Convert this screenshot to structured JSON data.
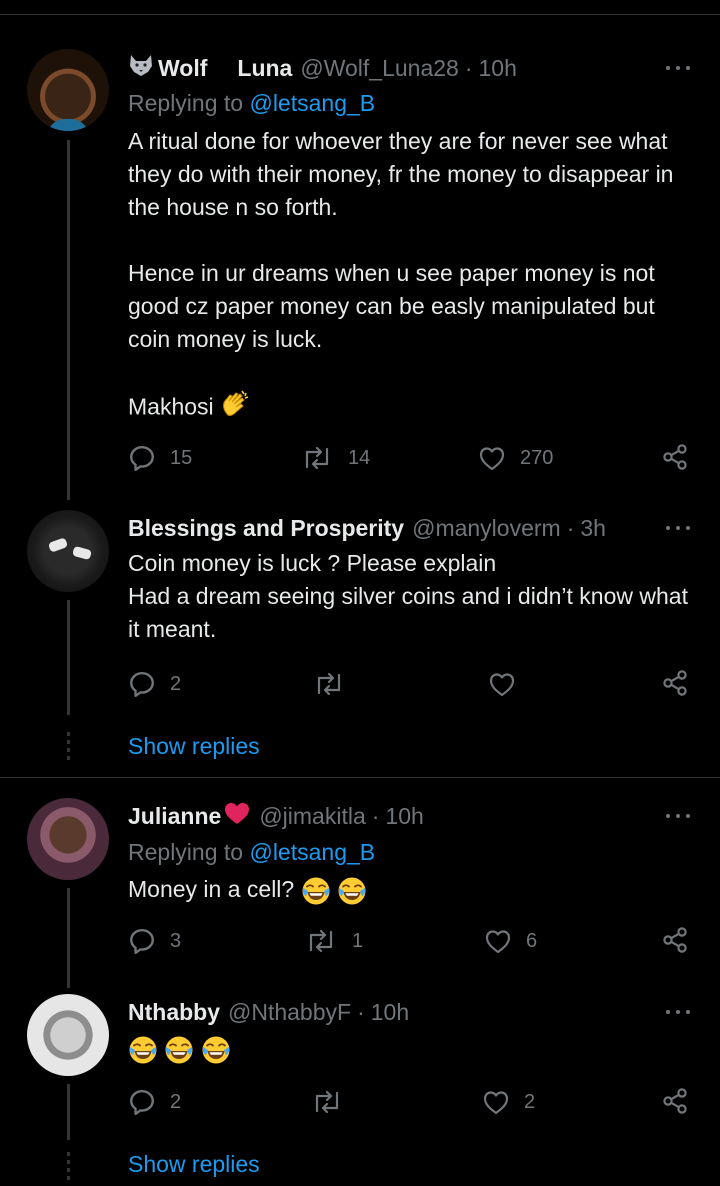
{
  "tweets": [
    {
      "name": "Wolf",
      "name2": "Luna",
      "handle": "@Wolf_Luna28",
      "time": "10h",
      "replying_label": "Replying to",
      "replying_handle": "@letsang_B",
      "body": [
        "A ritual done for whoever they are for never see what they do with their money, fr the money to disappear in the house n so forth.",
        "Hence in ur dreams when u see paper money is not good cz paper money can be easly manipulated but coin money is luck.",
        "Makhosi"
      ],
      "replies": "15",
      "retweets": "14",
      "likes": "270",
      "avatar_icon": "woman-portrait-avatar"
    },
    {
      "name": "Blessings and Prosperity",
      "handle": "@manyloverm",
      "time": "3h",
      "body": [
        "Coin money is luck ? Please explain",
        "Had a dream seeing silver coins and i didn’t know what it meant."
      ],
      "replies": "2",
      "retweets": "",
      "likes": "",
      "show_replies": "Show replies",
      "avatar_icon": "shoes-photo-avatar"
    },
    {
      "name": "Julianne",
      "handle": "@jimakitla",
      "time": "10h",
      "replying_label": "Replying to",
      "replying_handle": "@letsang_B",
      "body": [
        "Money in a cell?"
      ],
      "replies": "3",
      "retweets": "1",
      "likes": "6",
      "avatar_icon": "woman-portrait-avatar"
    },
    {
      "name": "Nthabby",
      "handle": "@NthabbyF",
      "time": "10h",
      "body": [
        ""
      ],
      "replies": "2",
      "retweets": "",
      "likes": "2",
      "show_replies": "Show replies",
      "avatar_icon": "woman-portrait-avatar"
    }
  ],
  "colors": {
    "background": "#000000",
    "text": "#e7e9ea",
    "muted": "#71767b",
    "accent": "#1d9bf0",
    "line": "#2f3336"
  },
  "icons": [
    "wolf-emoji-icon",
    "crescent-moon-emoji-icon",
    "clapping-hands-emoji-icon",
    "red-heart-emoji-icon",
    "tears-of-joy-emoji-icon",
    "reply-icon",
    "retweet-icon",
    "like-icon",
    "share-icon",
    "more-icon"
  ]
}
